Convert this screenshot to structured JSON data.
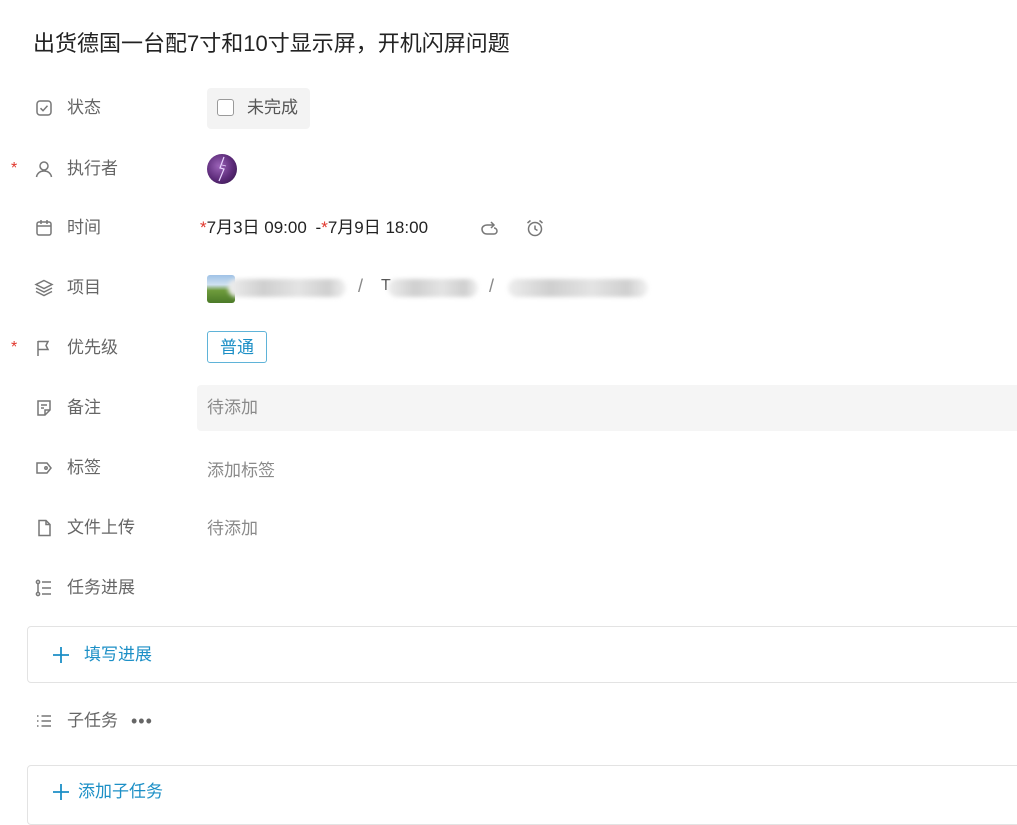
{
  "task": {
    "title": "出货德国一台配7寸和10寸显示屏，开机闪屏问题"
  },
  "fields": {
    "status": {
      "label": "状态",
      "value": "未完成",
      "icon": "check-square-icon"
    },
    "assignee": {
      "label": "执行者",
      "required_mark": "*",
      "icon": "user-icon",
      "avatar": "avatar"
    },
    "time": {
      "label": "时间",
      "icon": "calendar-icon",
      "start_mark": "*",
      "start": "7月3日 09:00",
      "separator": "-",
      "end_mark": "*",
      "end": "7月9日 18:00",
      "repeat_icon": "repeat-icon",
      "reminder_icon": "alarm-clock-icon"
    },
    "project": {
      "label": "项目",
      "icon": "layers-icon",
      "path_separator": "/",
      "partial_text": "T"
    },
    "priority": {
      "label": "优先级",
      "required_mark": "*",
      "icon": "flag-icon",
      "value": "普通"
    },
    "note": {
      "label": "备注",
      "icon": "note-icon",
      "placeholder": "待添加"
    },
    "tags": {
      "label": "标签",
      "icon": "tag-icon",
      "placeholder": "添加标签"
    },
    "files": {
      "label": "文件上传",
      "icon": "file-icon",
      "placeholder": "待添加"
    },
    "progress": {
      "label": "任务进展",
      "icon": "timeline-list-icon",
      "add_label": "填写进展"
    },
    "subtasks": {
      "label": "子任务",
      "icon": "list-icon",
      "more": "•••",
      "add_label": "添加子任务"
    }
  },
  "colors": {
    "required": "#e0362c",
    "accent": "#1c8fc6",
    "priority_border": "#5fb3d8",
    "label": "#666666"
  }
}
